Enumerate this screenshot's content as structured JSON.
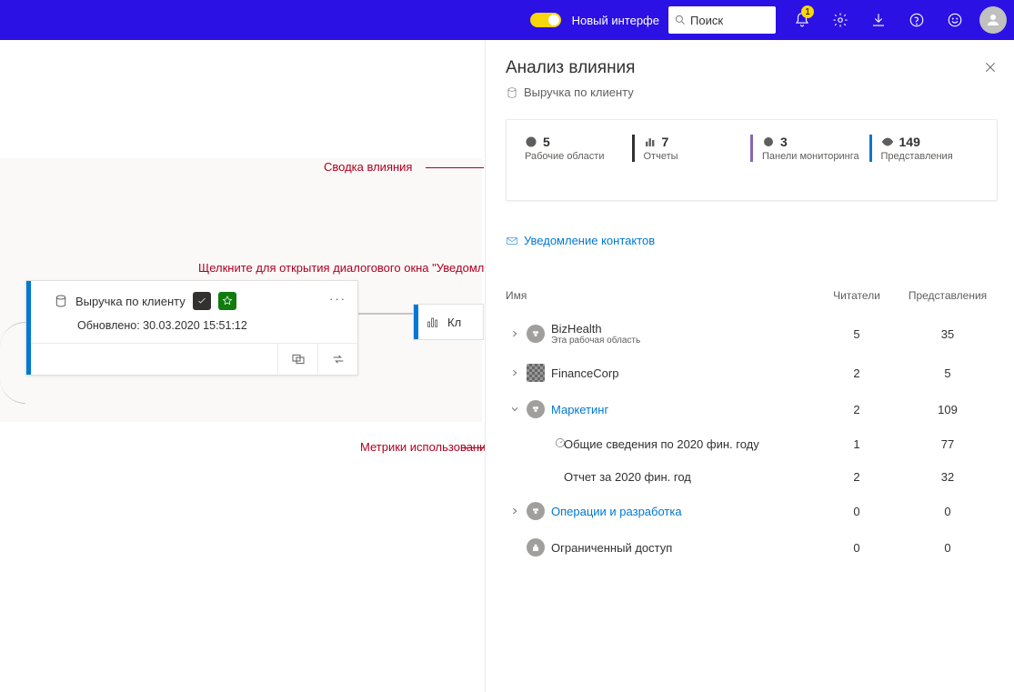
{
  "header": {
    "new_ui_label": "Новый интерфе",
    "search_placeholder": "Поиск",
    "notification_count": "1"
  },
  "canvas": {
    "node": {
      "title": "Выручка по клиенту",
      "updated": "Обновлено: 30.03.2020 15:51:12"
    },
    "mini_label": "Кл"
  },
  "annotations": {
    "summary": "Сводка влияния",
    "dialog_hint": "Щелкните для открытия диалогового окна \"Уведомление контактов\"",
    "usage": "Метрики использования",
    "notify_visible": "Уведомление контактов"
  },
  "panel": {
    "title": "Анализ влияния",
    "subtitle": "Выручка по клиенту",
    "summary": [
      {
        "value": "5",
        "label": "Рабочие области"
      },
      {
        "value": "7",
        "label": "Отчеты"
      },
      {
        "value": "3",
        "label": "Панели мониторинга"
      },
      {
        "value": "149",
        "label": "Представления"
      }
    ],
    "notify_link": "Уведомление контактов",
    "columns": {
      "name": "Имя",
      "readers": "Читатели",
      "views": "Представления"
    },
    "rows": [
      {
        "type": "ws",
        "title": "BizHealth",
        "sub": "Эта рабочая область",
        "readers": "5",
        "views": "35",
        "caret": "right"
      },
      {
        "type": "ws2",
        "title": "FinanceCorp",
        "readers": "2",
        "views": "5",
        "caret": "right"
      },
      {
        "type": "ws",
        "title": "Маркетинг",
        "readers": "2",
        "views": "109",
        "caret": "down",
        "link": true
      },
      {
        "type": "item",
        "icon": "dash",
        "title": "Общие сведения по 2020 фин. году",
        "readers": "1",
        "views": "77"
      },
      {
        "type": "item",
        "title": "Отчет за 2020 фин. год",
        "readers": "2",
        "views": "32"
      },
      {
        "type": "ws",
        "title": "Операции и    разработка",
        "readers": "0",
        "views": "0",
        "caret": "right",
        "link": true
      },
      {
        "type": "ws",
        "title": "Ограниченный доступ",
        "readers": "0",
        "views": "0",
        "caret": "",
        "restricted": true
      }
    ]
  }
}
